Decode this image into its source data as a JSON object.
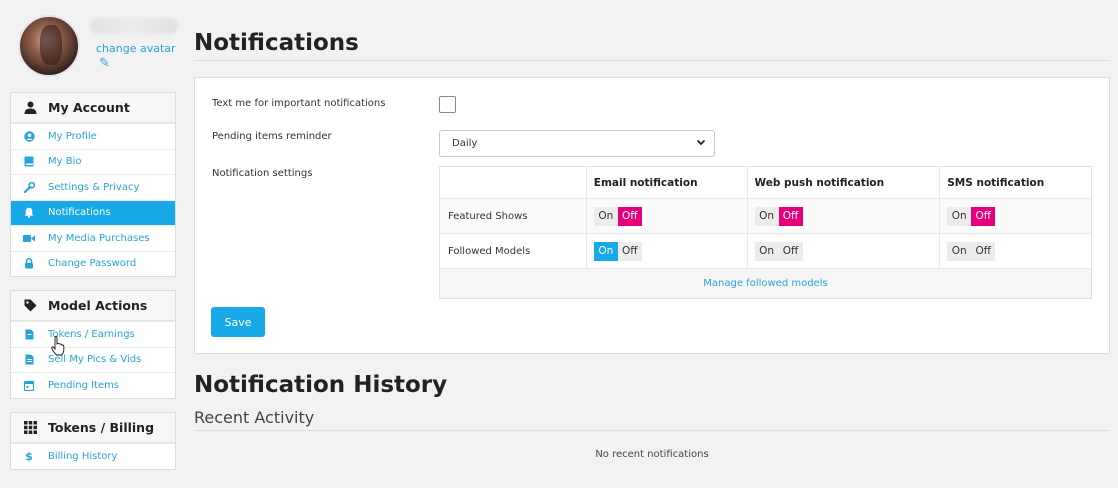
{
  "sidebar": {
    "change_avatar": "change avatar",
    "account": {
      "title": "My Account",
      "items": [
        {
          "label": "My Profile",
          "icon": "user-circle-icon"
        },
        {
          "label": "My Bio",
          "icon": "book-icon"
        },
        {
          "label": "Settings & Privacy",
          "icon": "wrench-icon"
        },
        {
          "label": "Notifications",
          "icon": "bell-icon",
          "active": true
        },
        {
          "label": "My Media Purchases",
          "icon": "video-camera-icon"
        },
        {
          "label": "Change Password",
          "icon": "lock-icon"
        }
      ]
    },
    "model_actions": {
      "title": "Model Actions",
      "items": [
        {
          "label": "Tokens / Earnings",
          "icon": "file-icon"
        },
        {
          "label": "Sell My Pics & Vids",
          "icon": "file-text-icon"
        },
        {
          "label": "Pending Items",
          "icon": "calendar-icon"
        }
      ]
    },
    "billing": {
      "title": "Tokens / Billing",
      "items": [
        {
          "label": "Billing History",
          "icon": "dollar-icon"
        }
      ]
    }
  },
  "main": {
    "title": "Notifications",
    "text_me_label": "Text me for important notifications",
    "pending_label": "Pending items reminder",
    "pending_value": "Daily",
    "settings_label": "Notification settings",
    "table": {
      "headers": [
        "",
        "Email notification",
        "Web push notification",
        "SMS notification"
      ],
      "rows": [
        {
          "label": "Featured Shows",
          "email": "Off",
          "web_push": "Off",
          "sms": "Off"
        },
        {
          "label": "Followed Models",
          "email": "On",
          "web_push": "Off",
          "sms": "Off"
        }
      ],
      "on_label": "On",
      "off_label": "Off",
      "manage_link": "Manage followed models"
    },
    "save_label": "Save",
    "history_title": "Notification History",
    "recent_title": "Recent Activity",
    "no_recent": "No recent notifications"
  },
  "colors": {
    "accent": "#17a9e8",
    "link": "#29a3d9",
    "toggle_off_selected": "#e6007e"
  }
}
